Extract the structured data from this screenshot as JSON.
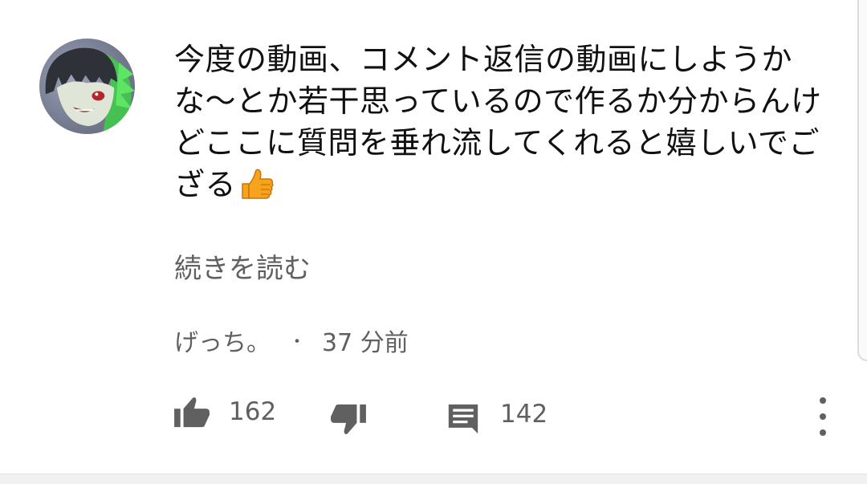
{
  "comment": {
    "text": "今度の動画、コメント返信の動画にしようかな〜とか若干思っているので作るか分からんけどここに質問を垂れ流してくれると嬉しいでござる",
    "emoji": "thumbs-up",
    "read_more_label": "続きを読む",
    "author": "げっち。",
    "separator": "・",
    "time_ago": "37 分前",
    "like_count": "162",
    "reply_count": "142"
  },
  "icons": {
    "like": "thumbs-up-icon",
    "dislike": "thumbs-down-icon",
    "reply": "comment-icon",
    "more": "more-vert-icon"
  },
  "colors": {
    "text": "#111111",
    "secondary": "#606060",
    "emoji_fill": "#f6a31d",
    "avatar_accent": "#4fd85a"
  }
}
